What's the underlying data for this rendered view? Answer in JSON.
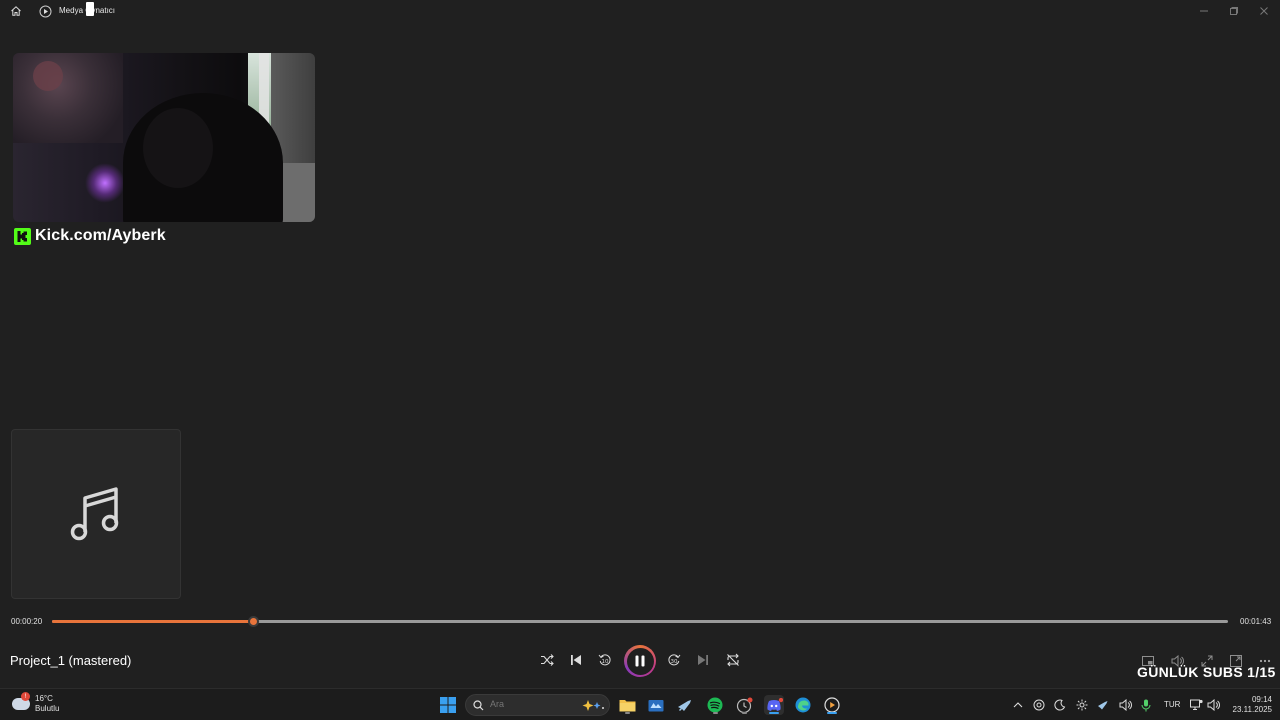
{
  "window": {
    "title": "Medya Oynatıcı"
  },
  "overlay": {
    "kick_text": "Kick.com/Ayberk",
    "subs_text": "GÜNLÜK SUBS 1/15"
  },
  "player": {
    "song_title": "Project_1 (mastered)",
    "elapsed": "00:00:20",
    "duration": "00:01:43",
    "progress": 0.171,
    "state": "playing",
    "accent_color": "#e8743b",
    "controls": [
      "shuffle-icon",
      "previous-icon",
      "rewind-10-icon",
      "pause-icon",
      "forward-30-icon",
      "next-icon",
      "repeat-off-icon"
    ],
    "right_controls": [
      "miniplayer-icon",
      "volume-icon",
      "fullscreen-icon",
      "compact-icon",
      "more-icon"
    ]
  },
  "taskbar": {
    "weather_temp": "16°C",
    "weather_desc": "Bulutlu",
    "weather_badge": "!",
    "search_placeholder": "Ara",
    "language": "TUR",
    "time": "09:14",
    "date": "23.11.2025",
    "apps": [
      "windows-start-icon",
      "file-explorer-icon",
      "store-icon",
      "steam-icon",
      "spotify-icon",
      "clock-app-icon",
      "discord-icon",
      "edge-icon",
      "media-player-icon"
    ]
  }
}
